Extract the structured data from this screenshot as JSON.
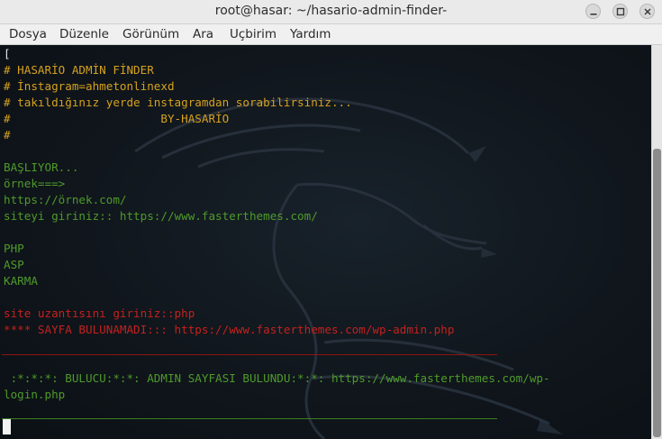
{
  "window": {
    "title": "root@hasar: ~/hasario-admin-finder-",
    "buttons": {
      "minimize_icon": "minimize-icon",
      "maximize_icon": "maximize-icon",
      "close_icon": "close-icon"
    }
  },
  "menubar": {
    "items": [
      "Dosya",
      "Düzenle",
      "Görünüm",
      "Ara",
      "Uçbirim",
      "Yardım"
    ]
  },
  "terminal": {
    "background_art": "kali-dragon",
    "lines": [
      "[",
      "# HASARİO ADMİN FİNDER",
      "# İnstagram=ahmetonlinexd",
      "# takıldığınız yerde instagramdan sorabilirsiniz...",
      "#                      BY-HASARİO",
      "#",
      "BAŞLIYOR...",
      "örnek===>",
      "https://örnek.com/",
      "siteyi giriniz:: https://www.fasterthemes.com/",
      "PHP",
      "ASP",
      "KARMA",
      "site uzantısını giriniz::php",
      "**** SAYFA BULUNAMADI::: https://www.fasterthemes.com/wp-admin.php",
      " :*:*:*: BULUCU:*:*: ADMIN SAYFASI BULUNDU:*:*: https://www.fasterthemes.com/wp-",
      "login.php"
    ],
    "colors": {
      "header": "#d6a11f",
      "output": "#4f9a2a",
      "error": "#c4211e",
      "text": "#e6e6e6"
    }
  },
  "scrollbar": {
    "position": 0.45
  }
}
